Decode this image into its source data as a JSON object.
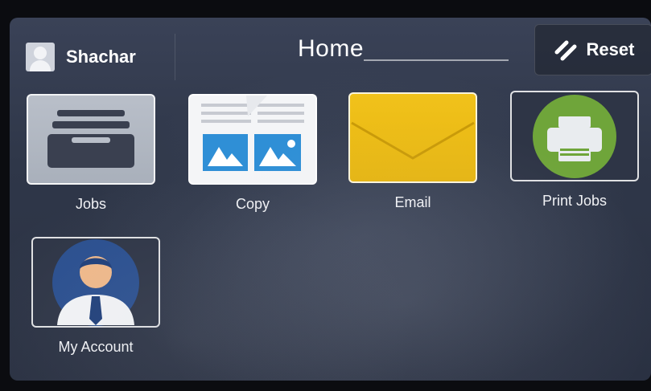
{
  "header": {
    "user_name": "Shachar",
    "title": "Home",
    "reset_label": "Reset"
  },
  "apps": [
    {
      "label": "Jobs",
      "icon": "jobs-drawer-icon"
    },
    {
      "label": "Copy",
      "icon": "copy-icon"
    },
    {
      "label": "Email",
      "icon": "email-envelope-icon"
    },
    {
      "label": "Print Jobs",
      "icon": "printer-icon"
    },
    {
      "label": "My Account",
      "icon": "account-person-icon"
    }
  ],
  "colors": {
    "email_yellow": "#f1c21b",
    "print_green": "#6fa53a",
    "copy_blue": "#2f8fd6",
    "screen_bg": "#2f3749"
  }
}
